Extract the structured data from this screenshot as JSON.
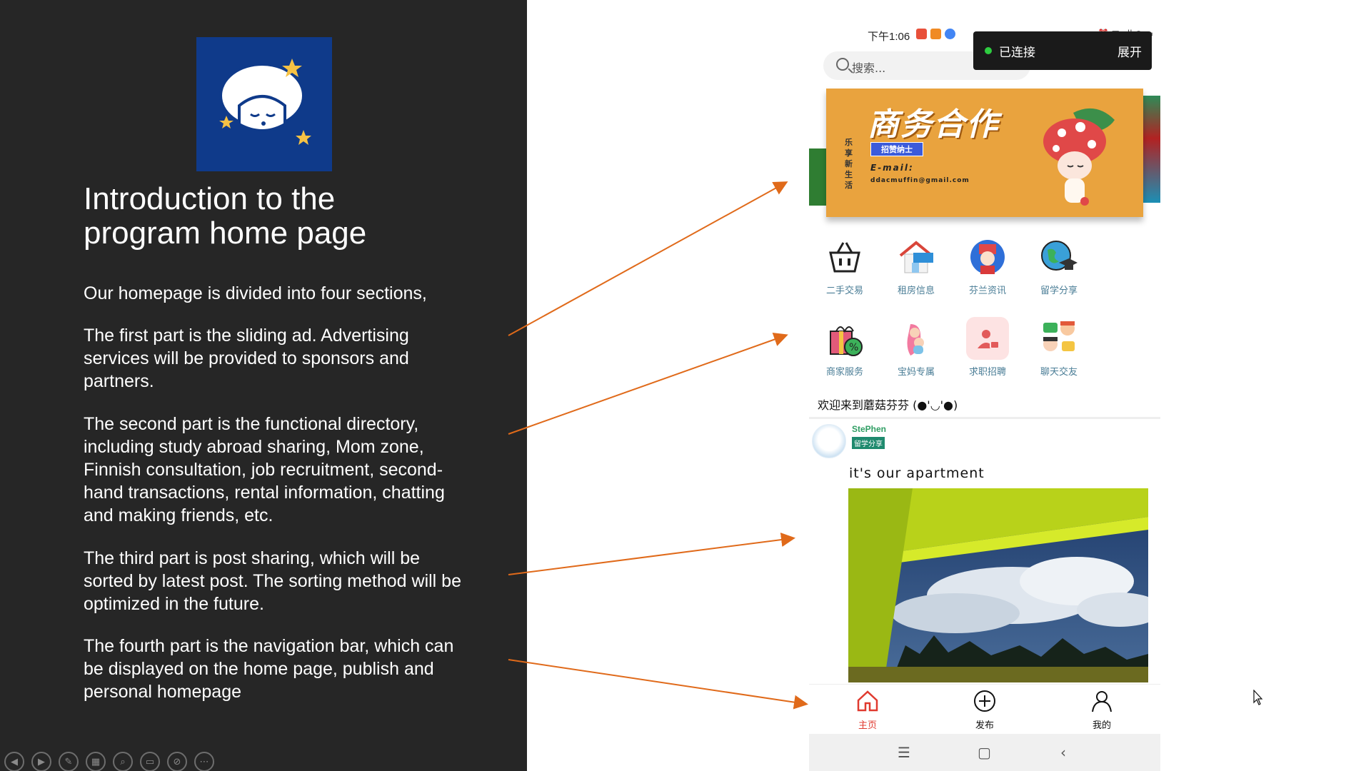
{
  "slide": {
    "title_line1": "Introduction to the",
    "title_line2": "program home page",
    "paragraphs": [
      "Our homepage is divided into four sections,",
      "The first part is the sliding ad. Advertising services will be provided to sponsors and partners.",
      "The second part is the functional directory, including study abroad sharing, Mom zone, Finnish consultation, job recruitment, second-hand transactions, rental information, chatting and making friends, etc.",
      "The third part is post sharing, which will be sorted by latest post. The sorting method will be optimized in the future.",
      "The fourth part is the navigation bar, which can be displayed on the home page, publish and personal homepage"
    ],
    "controls": [
      "prev-icon",
      "next-icon",
      "pen-icon",
      "slides-icon",
      "zoom-icon",
      "subtitle-icon",
      "camera-off-icon",
      "more-icon"
    ]
  },
  "phone": {
    "status": {
      "time": "下午1:06",
      "right_text": "⏰ ▦ .ıll ◠ ▭"
    },
    "search": {
      "placeholder": "搜索..."
    },
    "toast": {
      "label": "已连接",
      "expand": "展开"
    },
    "banner": {
      "title": "商务合作",
      "subtitle": "招赞纳士",
      "vertical_text": "乐享新生活",
      "email_label": "E-mail:",
      "email": "ddacmuffin@gmail.com"
    },
    "functions": [
      {
        "label": "二手交易",
        "icon": "basket-icon",
        "bg": "#ffffff"
      },
      {
        "label": "租房信息",
        "icon": "rent-house-icon",
        "bg": "#ffffff"
      },
      {
        "label": "芬兰资讯",
        "icon": "finland-guard-icon",
        "bg": "#ffffff"
      },
      {
        "label": "留学分享",
        "icon": "globe-graduation-icon",
        "bg": "#ffffff"
      },
      {
        "label": "商家服务",
        "icon": "gift-discount-icon",
        "bg": "#ffffff"
      },
      {
        "label": "宝妈专属",
        "icon": "mom-baby-icon",
        "bg": "#ffffff"
      },
      {
        "label": "求职招聘",
        "icon": "job-seeker-icon",
        "bg": "#fde3e3"
      },
      {
        "label": "聊天交友",
        "icon": "chat-friends-icon",
        "bg": "#ffffff"
      }
    ],
    "welcome": "欢迎来到蘑菇芬芬 (●'◡'●)",
    "post": {
      "user": "StePhen",
      "tag": "留学分享",
      "text": "it's our apartment"
    },
    "tabs": [
      {
        "label": "主页",
        "icon": "home-icon",
        "color": "#e03a2f"
      },
      {
        "label": "发布",
        "icon": "publish-plus-icon",
        "color": "#111111"
      },
      {
        "label": "我的",
        "icon": "profile-icon",
        "color": "#111111"
      }
    ],
    "sys_nav": [
      "menu-icon",
      "home-square-icon",
      "back-icon"
    ]
  },
  "colors": {
    "panel_bg": "#262626",
    "arrow": "#e06a1a",
    "banner_bg": "#e9a33e",
    "logo_bg": "#0f3a8a",
    "label_blue": "#4a7d96",
    "user_green": "#2f9e63"
  }
}
